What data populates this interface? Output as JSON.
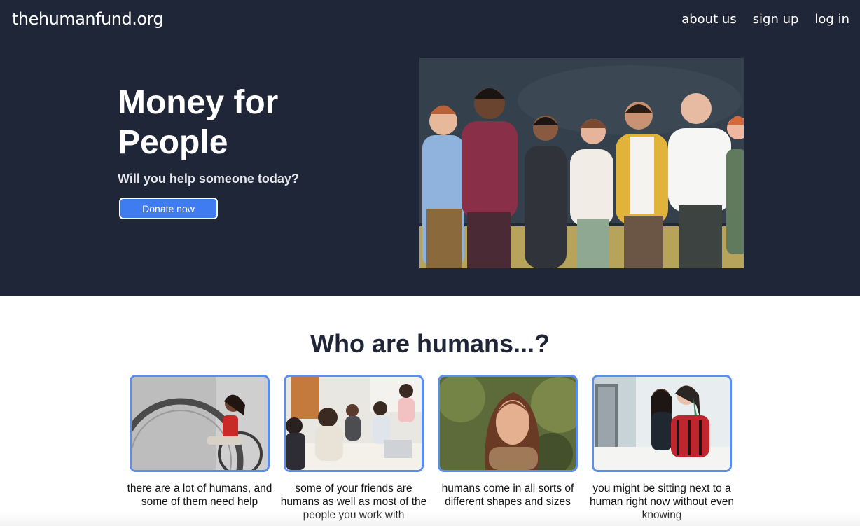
{
  "nav": {
    "logo": "thehumanfund.org",
    "links": [
      "about us",
      "sign up",
      "log in"
    ]
  },
  "hero": {
    "title": "Money for People",
    "subtitle": "Will you help someone today?",
    "button": "Donate now"
  },
  "section": {
    "title": "Who are humans...?"
  },
  "cards": [
    {
      "text": "there are a lot of humans, and some of them need help"
    },
    {
      "text": "some of your friends are humans as well as most of the people you work with"
    },
    {
      "text": "humans come in all sorts of different shapes and sizes"
    },
    {
      "text": "you might be sitting next to a human right now without even knowing"
    }
  ],
  "colors": {
    "header_bg": "#1f2638",
    "accent": "#3f7cf1",
    "card_border": "#5b8def"
  }
}
